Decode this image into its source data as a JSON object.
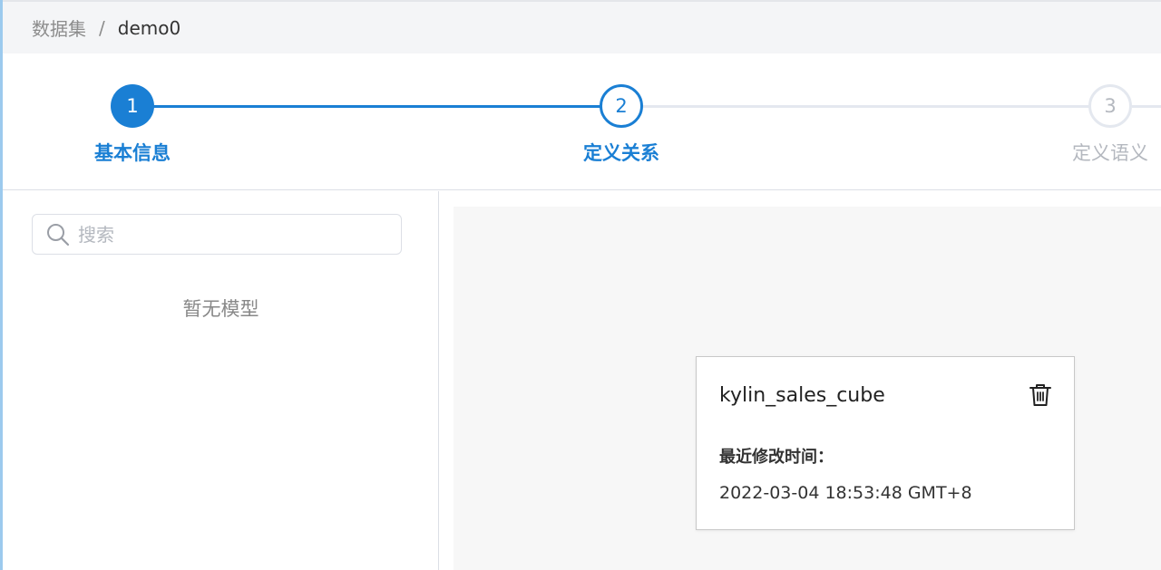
{
  "breadcrumb": {
    "root": "数据集",
    "separator": "/",
    "current": "demo0"
  },
  "steps": [
    {
      "number": "1",
      "label": "基本信息",
      "status": "done"
    },
    {
      "number": "2",
      "label": "定义关系",
      "status": "active"
    },
    {
      "number": "3",
      "label": "定义语义",
      "status": "pending"
    }
  ],
  "sidebar": {
    "search_placeholder": "搜索",
    "search_value": "",
    "empty_text": "暂无模型"
  },
  "model_card": {
    "name": "kylin_sales_cube",
    "modified_label": "最近修改时间：",
    "modified_time": "2022-03-04 18:53:48 GMT+8"
  },
  "colors": {
    "accent": "#1a7fd4",
    "inactive": "#b4b8bf",
    "canvas_bg": "#f7f7f7"
  }
}
